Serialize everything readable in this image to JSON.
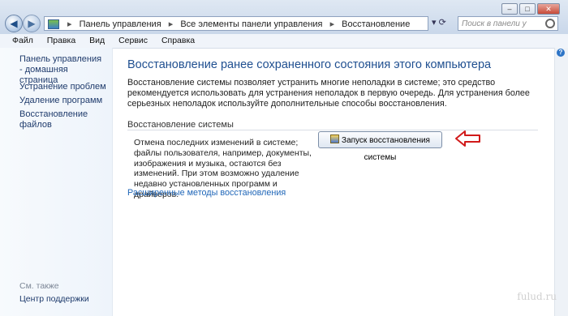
{
  "window": {
    "controls": {
      "minimize": "–",
      "maximize": "□",
      "close": "✕"
    }
  },
  "address": {
    "segments": [
      "Панель управления",
      "Все элементы панели управления",
      "Восстановление"
    ],
    "separator": "▸",
    "actions": "▾  ⟳"
  },
  "search": {
    "placeholder": "Поиск в панели у"
  },
  "menu": {
    "items": [
      "Файл",
      "Правка",
      "Вид",
      "Сервис",
      "Справка"
    ]
  },
  "sidebar": {
    "home_link": "Панель управления - домашняя страница",
    "items": [
      "Устранение проблем",
      "Удаление программ",
      "Восстановление файлов"
    ],
    "see_also": "См. также",
    "support_link": "Центр поддержки"
  },
  "main": {
    "title": "Восстановление ранее сохраненного состояния этого компьютера",
    "description": "Восстановление системы позволяет устранить многие неполадки в системе; это средство рекомендуется использовать для устранения неполадок в первую очередь. Для устранения более серьезных неполадок используйте дополнительные способы восстановления.",
    "group_title": "Восстановление системы",
    "group_description": "Отмена последних изменений в системе; файлы пользователя, например, документы, изображения и музыка, остаются без изменений. При этом возможно удаление недавно установленных программ и драйверов.",
    "button_label": "Запуск восстановления системы",
    "advanced_link": "Расширенные методы восстановления"
  },
  "help_label": "?",
  "watermark": "fulud.ru",
  "colors": {
    "title": "#1f4f90",
    "link": "#1f66b8",
    "annotation_arrow": "#d11a1a"
  }
}
